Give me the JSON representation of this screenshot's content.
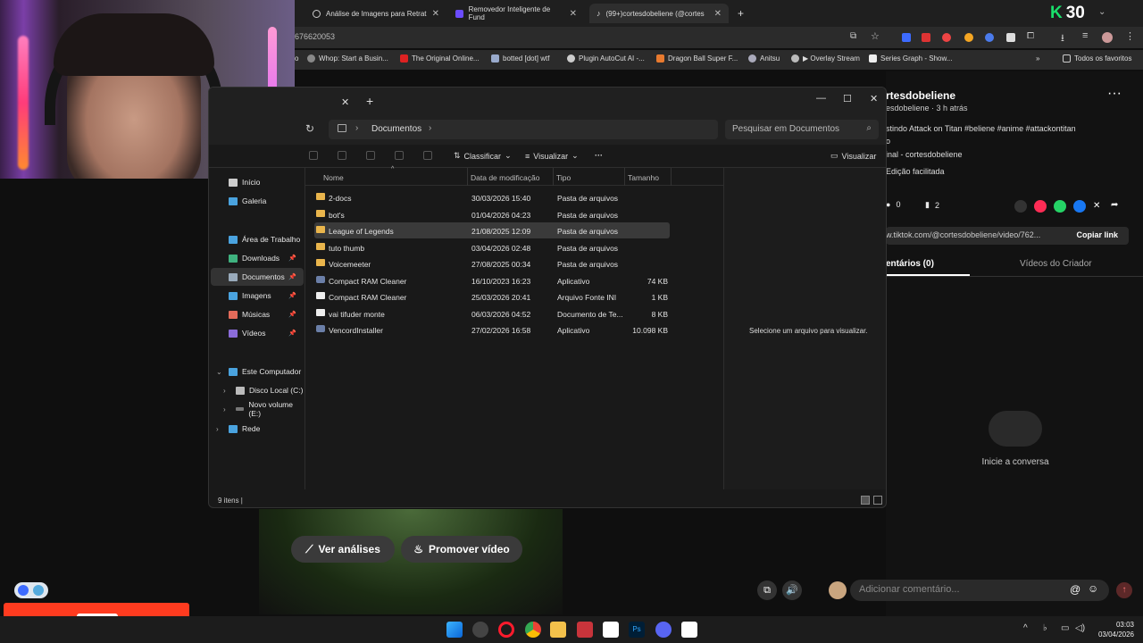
{
  "browser": {
    "tabs": [
      {
        "label": "Análise de Imagens para Retrat"
      },
      {
        "label": "Removedor Inteligente de Fund"
      },
      {
        "label": "(99+)cortesdobeliene (@cortes"
      }
    ],
    "badge_number": "30",
    "url": "676620053",
    "bookmarks": [
      {
        "label": "Whop: Start a Busin..."
      },
      {
        "label": "The Original Online..."
      },
      {
        "label": "botted [dot] wtf"
      },
      {
        "label": "Plugin AutoCut AI -..."
      },
      {
        "label": "Dragon Ball Super F..."
      },
      {
        "label": "Anitsu"
      },
      {
        "label": "▶ Overlay Stream"
      },
      {
        "label": "Series Graph - Show..."
      },
      {
        "label": "Todos os favoritos"
      }
    ]
  },
  "tiktok": {
    "name": "rtesdobeliene",
    "meta": "esdobeliene · 3 h atrás",
    "desc": "stindo Attack on Titan #beliene #anime #attackontitan",
    "desc2": "o",
    "music": "inal - cortesdobeliene",
    "edit": "Edição facilitada",
    "comments_count": "0",
    "saves_count": "2",
    "link": "w.tiktok.com/@cortesdobeliene/video/762...",
    "copy_link": "Copiar link",
    "tab_comments": "entários (0)",
    "tab_creator": "Vídeos do Criador",
    "empty_msg": "Inicie a conversa",
    "comment_placeholder": "Adicionar comentário..."
  },
  "video_buttons": {
    "analyses": "Ver análises",
    "promote": "Promover vídeo"
  },
  "explorer": {
    "breadcrumb": "Documentos",
    "search_placeholder": "Pesquisar em Documentos",
    "toolbar": {
      "sort": "Classificar",
      "view": "Visualizar",
      "more": "···",
      "details": "Visualizar"
    },
    "sidebar": [
      {
        "label": "Início"
      },
      {
        "label": "Galeria"
      },
      {
        "label": "Área de Trabalho"
      },
      {
        "label": "Downloads"
      },
      {
        "label": "Documentos"
      },
      {
        "label": "Imagens"
      },
      {
        "label": "Músicas"
      },
      {
        "label": "Vídeos"
      },
      {
        "label": "Este Computador"
      },
      {
        "label": "Disco Local (C:)"
      },
      {
        "label": "Novo volume (E:)"
      },
      {
        "label": "Rede"
      }
    ],
    "columns": {
      "name": "Nome",
      "modified": "Data de modificação",
      "type": "Tipo",
      "size": "Tamanho"
    },
    "files": [
      {
        "name": "2-docs",
        "modified": "30/03/2026 15:40",
        "type": "Pasta de arquivos",
        "size": "",
        "kind": "folder"
      },
      {
        "name": "bot's",
        "modified": "01/04/2026 04:23",
        "type": "Pasta de arquivos",
        "size": "",
        "kind": "folder"
      },
      {
        "name": "League of Legends",
        "modified": "21/08/2025 12:09",
        "type": "Pasta de arquivos",
        "size": "",
        "kind": "folder"
      },
      {
        "name": "tuto thumb",
        "modified": "03/04/2026 02:48",
        "type": "Pasta de arquivos",
        "size": "",
        "kind": "folder"
      },
      {
        "name": "Voicemeeter",
        "modified": "27/08/2025 00:34",
        "type": "Pasta de arquivos",
        "size": "",
        "kind": "folder"
      },
      {
        "name": "Compact RAM Cleaner",
        "modified": "16/10/2023 16:23",
        "type": "Aplicativo",
        "size": "74 KB",
        "kind": "app"
      },
      {
        "name": "Compact RAM Cleaner",
        "modified": "25/03/2026 20:41",
        "type": "Arquivo Fonte INI",
        "size": "1 KB",
        "kind": "doc"
      },
      {
        "name": "vai tifuder monte",
        "modified": "06/03/2026 04:52",
        "type": "Documento de Te...",
        "size": "8 KB",
        "kind": "doc"
      },
      {
        "name": "VencordInstaller",
        "modified": "27/02/2026 16:58",
        "type": "Aplicativo",
        "size": "10.098 KB",
        "kind": "app"
      }
    ],
    "preview_msg": "Selecione um arquivo para visualizar.",
    "status": "9 itens  |"
  },
  "clock": {
    "time": "03:03",
    "date": "03/04/2026"
  }
}
